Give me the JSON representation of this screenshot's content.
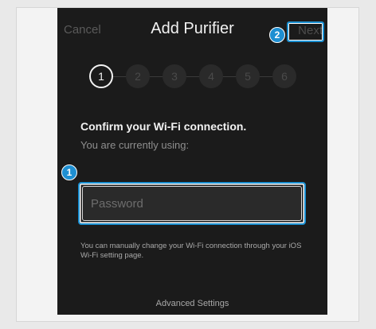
{
  "navbar": {
    "cancel_label": "Cancel",
    "title": "Add Purifier",
    "next_label": "Next"
  },
  "callouts": {
    "password": "1",
    "next": "2"
  },
  "steps": {
    "items": [
      "1",
      "2",
      "3",
      "4",
      "5",
      "6"
    ],
    "current": 1
  },
  "content": {
    "heading": "Confirm your Wi-Fi connection.",
    "subheading": "You are currently using:",
    "password_placeholder": "Password",
    "password_value": "",
    "note": "You can manually change your Wi-Fi connection through your iOS Wi-Fi setting page.",
    "advanced_label": "Advanced Settings"
  },
  "colors": {
    "highlight": "#1a8fd1",
    "screen_background": "#1b1b1b"
  }
}
